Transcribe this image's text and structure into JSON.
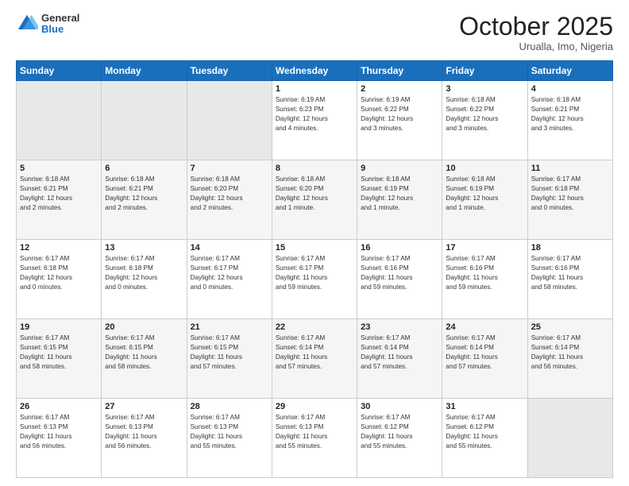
{
  "header": {
    "logo": {
      "line1": "General",
      "line2": "Blue"
    },
    "title": "October 2025",
    "subtitle": "Urualla, Imo, Nigeria"
  },
  "weekdays": [
    "Sunday",
    "Monday",
    "Tuesday",
    "Wednesday",
    "Thursday",
    "Friday",
    "Saturday"
  ],
  "weeks": [
    [
      {
        "day": "",
        "info": ""
      },
      {
        "day": "",
        "info": ""
      },
      {
        "day": "",
        "info": ""
      },
      {
        "day": "1",
        "info": "Sunrise: 6:19 AM\nSunset: 6:23 PM\nDaylight: 12 hours\nand 4 minutes."
      },
      {
        "day": "2",
        "info": "Sunrise: 6:19 AM\nSunset: 6:22 PM\nDaylight: 12 hours\nand 3 minutes."
      },
      {
        "day": "3",
        "info": "Sunrise: 6:18 AM\nSunset: 6:22 PM\nDaylight: 12 hours\nand 3 minutes."
      },
      {
        "day": "4",
        "info": "Sunrise: 6:18 AM\nSunset: 6:21 PM\nDaylight: 12 hours\nand 3 minutes."
      }
    ],
    [
      {
        "day": "5",
        "info": "Sunrise: 6:18 AM\nSunset: 6:21 PM\nDaylight: 12 hours\nand 2 minutes."
      },
      {
        "day": "6",
        "info": "Sunrise: 6:18 AM\nSunset: 6:21 PM\nDaylight: 12 hours\nand 2 minutes."
      },
      {
        "day": "7",
        "info": "Sunrise: 6:18 AM\nSunset: 6:20 PM\nDaylight: 12 hours\nand 2 minutes."
      },
      {
        "day": "8",
        "info": "Sunrise: 6:18 AM\nSunset: 6:20 PM\nDaylight: 12 hours\nand 1 minute."
      },
      {
        "day": "9",
        "info": "Sunrise: 6:18 AM\nSunset: 6:19 PM\nDaylight: 12 hours\nand 1 minute."
      },
      {
        "day": "10",
        "info": "Sunrise: 6:18 AM\nSunset: 6:19 PM\nDaylight: 12 hours\nand 1 minute."
      },
      {
        "day": "11",
        "info": "Sunrise: 6:17 AM\nSunset: 6:18 PM\nDaylight: 12 hours\nand 0 minutes."
      }
    ],
    [
      {
        "day": "12",
        "info": "Sunrise: 6:17 AM\nSunset: 6:18 PM\nDaylight: 12 hours\nand 0 minutes."
      },
      {
        "day": "13",
        "info": "Sunrise: 6:17 AM\nSunset: 6:18 PM\nDaylight: 12 hours\nand 0 minutes."
      },
      {
        "day": "14",
        "info": "Sunrise: 6:17 AM\nSunset: 6:17 PM\nDaylight: 12 hours\nand 0 minutes."
      },
      {
        "day": "15",
        "info": "Sunrise: 6:17 AM\nSunset: 6:17 PM\nDaylight: 11 hours\nand 59 minutes."
      },
      {
        "day": "16",
        "info": "Sunrise: 6:17 AM\nSunset: 6:16 PM\nDaylight: 11 hours\nand 59 minutes."
      },
      {
        "day": "17",
        "info": "Sunrise: 6:17 AM\nSunset: 6:16 PM\nDaylight: 11 hours\nand 59 minutes."
      },
      {
        "day": "18",
        "info": "Sunrise: 6:17 AM\nSunset: 6:16 PM\nDaylight: 11 hours\nand 58 minutes."
      }
    ],
    [
      {
        "day": "19",
        "info": "Sunrise: 6:17 AM\nSunset: 6:15 PM\nDaylight: 11 hours\nand 58 minutes."
      },
      {
        "day": "20",
        "info": "Sunrise: 6:17 AM\nSunset: 6:15 PM\nDaylight: 11 hours\nand 58 minutes."
      },
      {
        "day": "21",
        "info": "Sunrise: 6:17 AM\nSunset: 6:15 PM\nDaylight: 11 hours\nand 57 minutes."
      },
      {
        "day": "22",
        "info": "Sunrise: 6:17 AM\nSunset: 6:14 PM\nDaylight: 11 hours\nand 57 minutes."
      },
      {
        "day": "23",
        "info": "Sunrise: 6:17 AM\nSunset: 6:14 PM\nDaylight: 11 hours\nand 57 minutes."
      },
      {
        "day": "24",
        "info": "Sunrise: 6:17 AM\nSunset: 6:14 PM\nDaylight: 11 hours\nand 57 minutes."
      },
      {
        "day": "25",
        "info": "Sunrise: 6:17 AM\nSunset: 6:14 PM\nDaylight: 11 hours\nand 56 minutes."
      }
    ],
    [
      {
        "day": "26",
        "info": "Sunrise: 6:17 AM\nSunset: 6:13 PM\nDaylight: 11 hours\nand 56 minutes."
      },
      {
        "day": "27",
        "info": "Sunrise: 6:17 AM\nSunset: 6:13 PM\nDaylight: 11 hours\nand 56 minutes."
      },
      {
        "day": "28",
        "info": "Sunrise: 6:17 AM\nSunset: 6:13 PM\nDaylight: 11 hours\nand 55 minutes."
      },
      {
        "day": "29",
        "info": "Sunrise: 6:17 AM\nSunset: 6:13 PM\nDaylight: 11 hours\nand 55 minutes."
      },
      {
        "day": "30",
        "info": "Sunrise: 6:17 AM\nSunset: 6:12 PM\nDaylight: 11 hours\nand 55 minutes."
      },
      {
        "day": "31",
        "info": "Sunrise: 6:17 AM\nSunset: 6:12 PM\nDaylight: 11 hours\nand 55 minutes."
      },
      {
        "day": "",
        "info": ""
      }
    ]
  ]
}
